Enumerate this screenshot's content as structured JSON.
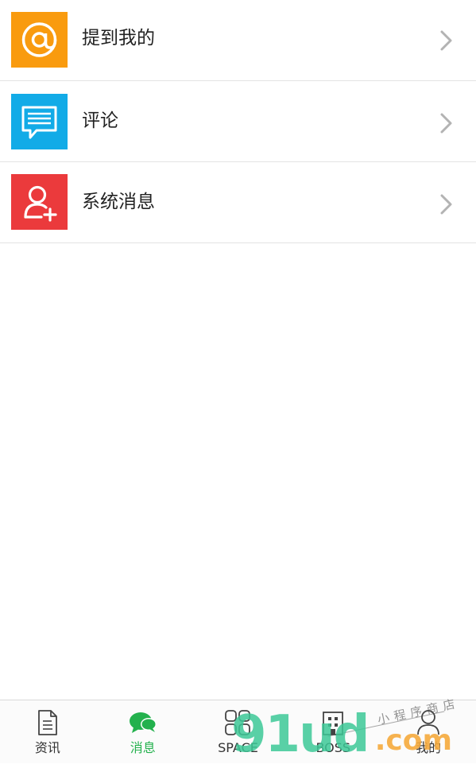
{
  "list": {
    "items": [
      {
        "label": "提到我的",
        "icon": "at-sign-icon",
        "color": "#f99b0f"
      },
      {
        "label": "评论",
        "icon": "chat-bubble-icon",
        "color": "#12abe7"
      },
      {
        "label": "系统消息",
        "icon": "add-user-icon",
        "color": "#eb3a3c"
      }
    ]
  },
  "tabbar": {
    "active_color": "#23b14d",
    "tabs": [
      {
        "label": "资讯",
        "icon": "document-icon"
      },
      {
        "label": "消息",
        "icon": "chat-bubbles-icon",
        "active": true
      },
      {
        "label": "SPACE",
        "icon": "grid-icon"
      },
      {
        "label": "BOSS",
        "icon": "building-icon"
      },
      {
        "label": "我的",
        "icon": "person-icon"
      }
    ]
  },
  "watermark": {
    "main": "91ud",
    "suffix": ".com",
    "tagline": "小程序商店"
  }
}
